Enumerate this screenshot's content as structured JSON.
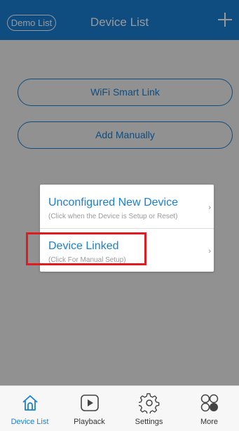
{
  "navbar": {
    "left_button": "Demo List",
    "title": "Device List",
    "right_icon": "plus-icon"
  },
  "actions": {
    "wifi_smart_link": "WiFi Smart Link",
    "add_manually": "Add Manually"
  },
  "popup": {
    "items": [
      {
        "title": "Unconfigured New Device",
        "subtitle": "(Click when the Device is Setup or Reset)",
        "chevron": "›"
      },
      {
        "title": "Device Linked",
        "subtitle": "(Click For Manual Setup)",
        "chevron": "›"
      }
    ]
  },
  "tabbar": {
    "items": [
      {
        "label": "Device List",
        "icon": "home-icon"
      },
      {
        "label": "Playback",
        "icon": "play-icon"
      },
      {
        "label": "Settings",
        "icon": "gear-icon"
      },
      {
        "label": "More",
        "icon": "more-icon"
      }
    ]
  },
  "colors": {
    "accent": "#1a7fd6",
    "highlight": "#e11b22"
  }
}
